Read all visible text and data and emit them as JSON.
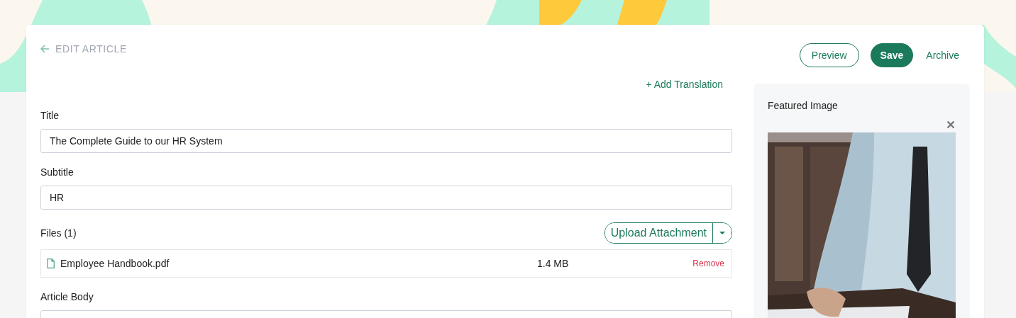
{
  "header": {
    "title": "EDIT ARTICLE"
  },
  "actions": [
    {
      "label": "Preview",
      "kind": "outline"
    },
    {
      "label": "Save",
      "kind": "primary"
    },
    {
      "label": "Archive",
      "kind": "link"
    }
  ],
  "add_translation": "+ Add Translation",
  "fields": [
    {
      "label": "Title",
      "value": "The Complete Guide to our HR System"
    },
    {
      "label": "Subtitle",
      "value": "HR"
    }
  ],
  "files": {
    "label": "Files (1)",
    "upload_button": "Upload Attachment",
    "items": [
      {
        "name": "Employee Handbook.pdf",
        "size": "1.4 MB",
        "action": "Remove"
      }
    ]
  },
  "article_body": {
    "label": "Article Body"
  },
  "featured_image": {
    "label": "Featured Image",
    "kind": "picture"
  }
}
